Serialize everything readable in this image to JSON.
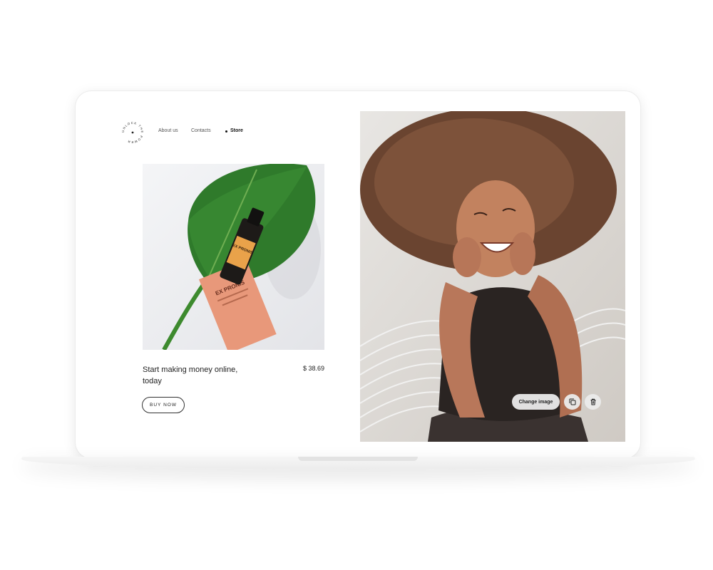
{
  "brand": {
    "logo_text": "UNLOCK THE POWER"
  },
  "nav": {
    "items": [
      {
        "label": "About us"
      },
      {
        "label": "Contacts"
      },
      {
        "label": "Store",
        "active": true
      }
    ]
  },
  "product": {
    "image_icon": "serum-bottle-on-leaf-image",
    "bottle_label": "EX PRONIS",
    "title": "Start making money online, today",
    "price": "$ 38.69",
    "buy_label": "BUY NOW"
  },
  "hero": {
    "image_icon": "smiling-woman-photo",
    "toolbar": {
      "change_label": "Change image",
      "duplicate_icon": "copy-icon",
      "delete_icon": "trash-icon"
    }
  },
  "colors": {
    "accent_box": "#e8987a",
    "leaf": "#2f7a2b",
    "toolbar_bg": "#ebebeb"
  }
}
